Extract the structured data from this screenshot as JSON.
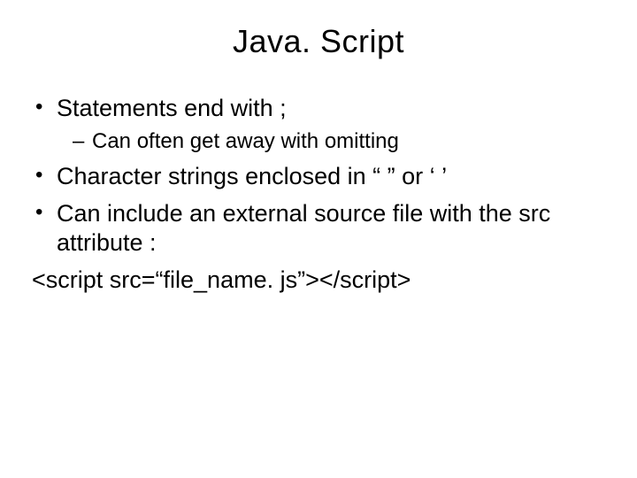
{
  "title": "Java. Script",
  "bullets": {
    "b1": "Statements end with ;",
    "b1_sub1": "Can often get away with omitting",
    "b2": "Character strings enclosed in  “  ” or  ‘ ’",
    "b3": "Can include an external source file with the src attribute :"
  },
  "code_line": "<script src=“file_name. js”></script>"
}
